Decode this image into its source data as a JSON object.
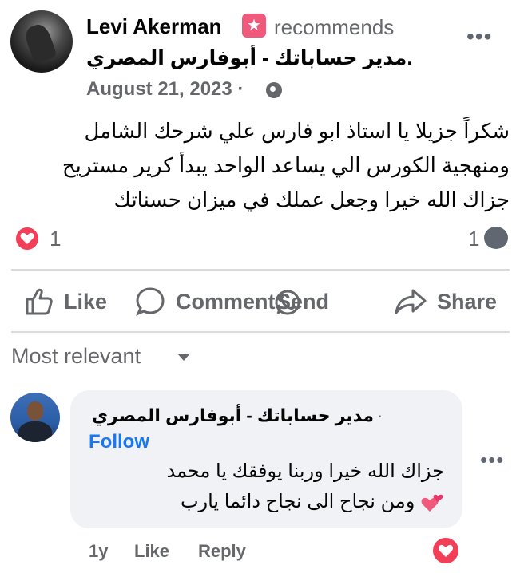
{
  "post": {
    "author": "Levi Akerman",
    "badge_icon": "recommendation-star-icon",
    "recommends_text": "recommends",
    "page_name": "مدير حساباتك - أبوفارس المصري.",
    "date": "August 21, 2023 ·",
    "audience_icon": "globe-icon",
    "body_lines": [
      "شكراً جزيلا يا استاذ ابو فارس علي شرحك الشامل",
      "ومنهجية الكورس الي يساعد الواحد يبدأ كرير مستريح",
      "جزاك الله خيرا وجعل عملك في ميزان حسناتك"
    ],
    "reaction_count": "1",
    "comment_count": "1"
  },
  "actions": {
    "like": "Like",
    "comment": "Comment",
    "send": "Send",
    "share": "Share"
  },
  "sort_label": "Most relevant",
  "comment": {
    "author": "مدير حساباتك - أبوفارس المصري",
    "separator": "·",
    "follow_label": "Follow",
    "text_lines": [
      "جزاك الله خيرا وربنا يوفقك يا محمد",
      "ومن نجاح الى نجاح دائما يارب"
    ],
    "time": "1y",
    "like_label": "Like",
    "reply_label": "Reply"
  },
  "colors": {
    "link_blue": "#1877f2",
    "secondary_text": "#65676b",
    "heart_red": "#f33e58",
    "bubble_bg": "#f0f2f5"
  }
}
